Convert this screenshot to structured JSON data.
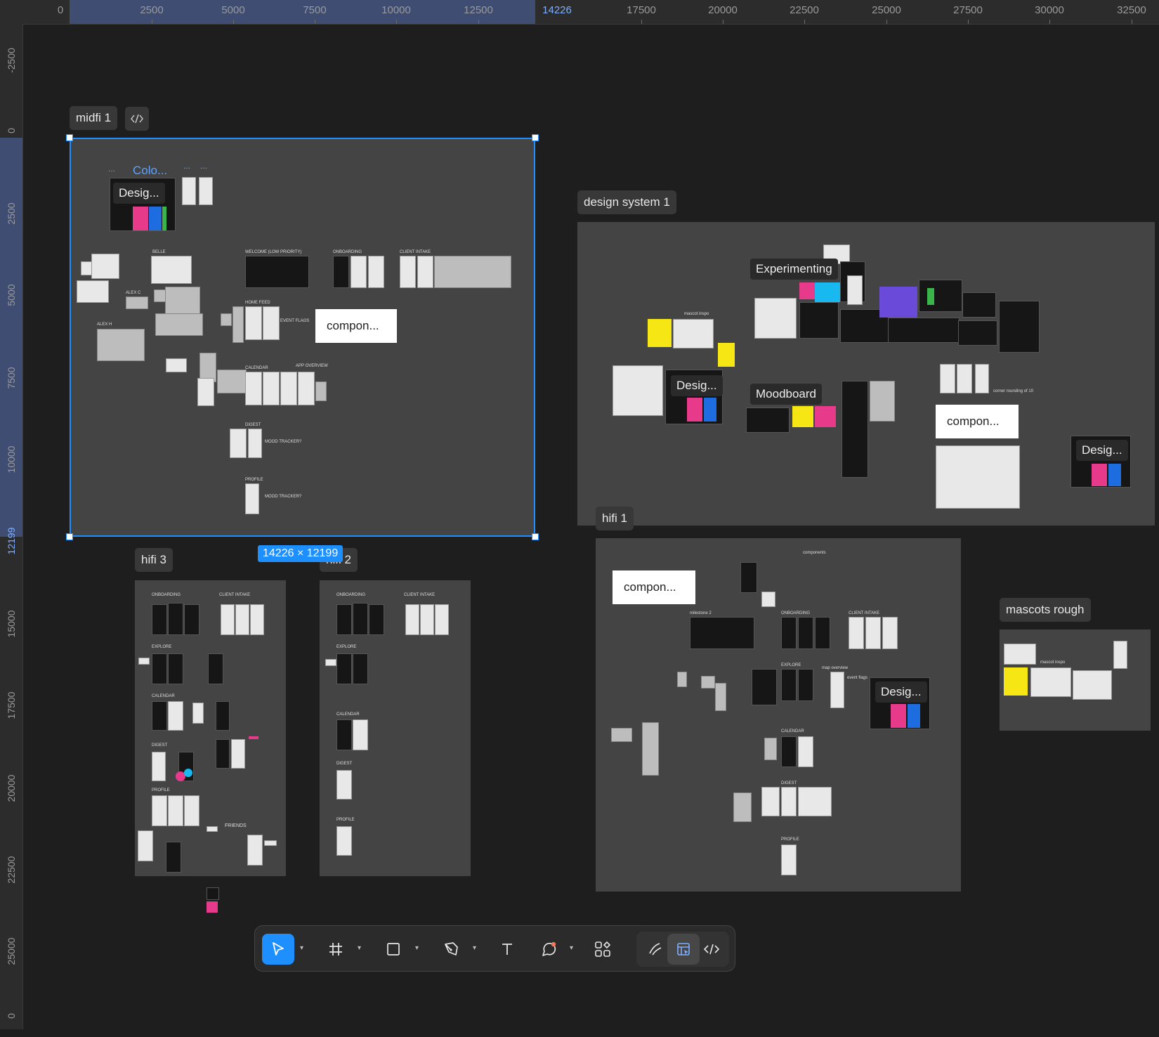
{
  "rulers": {
    "top": [
      "0",
      "2500",
      "5000",
      "7500",
      "10000",
      "12500",
      "14226",
      "17500",
      "20000",
      "22500",
      "25000",
      "27500",
      "30000",
      "32500"
    ],
    "top_active": "14226",
    "left": [
      "-2500",
      "0",
      "2500",
      "5000",
      "7500",
      "10000",
      "12199",
      "15000",
      "17500",
      "20000",
      "22500",
      "25000",
      "0"
    ],
    "left_active": "12199"
  },
  "frames": {
    "midfi": {
      "label": "midfi 1",
      "size_badge": "14226 × 12199",
      "texts": {
        "colo": "Colo...",
        "desig": "Desig...",
        "compon": "compon...",
        "belle": "BELLE",
        "alexc": "ALEX C",
        "alexh": "ALEX H",
        "welcome": "WELCOME (low priority)",
        "onboarding": "ONBOARDING",
        "client_intake": "CLIENT INTAKE",
        "home_feed": "HOME FEED",
        "event_flags": "event flags",
        "calendar": "CALENDAR",
        "app_overview": "app overview",
        "digest": "DIGEST",
        "mood1": "mood tracker?",
        "profile": "PROFILE",
        "mood2": "mood tracker?"
      }
    },
    "design_system": {
      "label": "design system 1",
      "texts": {
        "experimenting": "Experimenting",
        "moodboard": "Moodboard",
        "desig1": "Desig...",
        "desig2": "Desig...",
        "compon": "compon...",
        "mascot_inspo": "mascot inspo",
        "corner": "corner rounding of 10"
      }
    },
    "hifi1": {
      "label": "hifi 1",
      "texts": {
        "compon": "compon...",
        "desig": "Desig...",
        "components": "components",
        "milestone": "milestone 2",
        "onboarding": "ONBOARDING",
        "client_intake": "CLIENT INTAKE",
        "explore": "EXPLORE",
        "map_overview": "map overview",
        "event_flags": "event flags",
        "calendar": "CALENDAR",
        "digest": "DIGEST",
        "profile": "PROFILE"
      }
    },
    "hifi3": {
      "label": "hifi 3",
      "texts": {
        "onboarding": "ONBOARDING",
        "client_intake": "CLIENT INTAKE",
        "explore": "EXPLORE",
        "calendar": "CALENDAR",
        "digest": "DIGEST",
        "profile": "PROFILE",
        "friends": "Friends"
      }
    },
    "hifi2": {
      "label": "hifi 2",
      "texts": {
        "onboarding": "ONBOARDING",
        "client_intake": "CLIENT INTAKE",
        "explore": "EXPLORE",
        "calendar": "CALENDAR",
        "digest": "DIGEST",
        "profile": "PROFILE"
      }
    },
    "mascots": {
      "label": "mascots rough",
      "texts": {
        "mascot_inspo": "mascot inspo"
      }
    }
  },
  "toolbar": {
    "tools": [
      "move-tool",
      "frame-tool",
      "shape-tool",
      "pen-tool",
      "text-tool",
      "comment-tool",
      "actions-tool"
    ],
    "modes": [
      "draw-mode",
      "design-mode",
      "dev-mode"
    ],
    "active_tool": "move-tool",
    "active_mode": "design-mode"
  },
  "colors": {
    "accent": "#1e8fff",
    "canvas": "#1e1e1e",
    "frame": "#444444"
  }
}
